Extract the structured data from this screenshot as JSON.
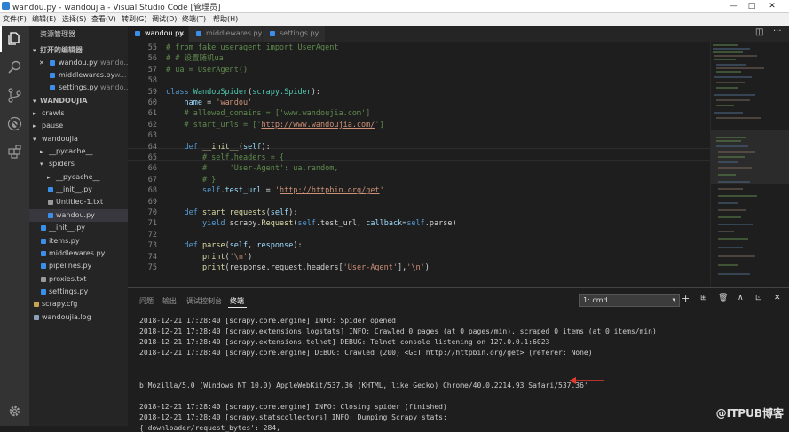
{
  "window": {
    "title": "wandou.py - wandoujia - Visual Studio Code [管理员]",
    "controls": [
      "—",
      "□",
      "✕"
    ]
  },
  "menu": [
    "文件(F)",
    "编辑(E)",
    "选择(S)",
    "查看(V)",
    "转到(G)",
    "调试(D)",
    "终端(T)",
    "帮助(H)"
  ],
  "activity_bar": [
    "explorer-icon",
    "search-icon",
    "source-control-icon",
    "debug-icon",
    "extensions-icon",
    "gear-icon"
  ],
  "sidebar": {
    "title": "资源管理器",
    "open_editors_label": "打开的编辑器",
    "open_editors": [
      {
        "name": "wandou.py",
        "dir": "wando..."
      },
      {
        "name": "middlewares.py",
        "dir": "w..."
      },
      {
        "name": "settings.py",
        "dir": "wando..."
      }
    ],
    "project_label": "WANDOUJIA",
    "tree": [
      {
        "label": "crawls",
        "type": "folder",
        "indent": 1
      },
      {
        "label": "pause",
        "type": "folder",
        "indent": 1
      },
      {
        "label": "wandoujia",
        "type": "folder-open",
        "indent": 1
      },
      {
        "label": "__pycache__",
        "type": "folder",
        "indent": 2
      },
      {
        "label": "spiders",
        "type": "folder-open",
        "indent": 2
      },
      {
        "label": "__pycache__",
        "type": "folder",
        "indent": 3
      },
      {
        "label": "__init__.py",
        "type": "py",
        "indent": 3
      },
      {
        "label": "Untitled-1.txt",
        "type": "txt",
        "indent": 3
      },
      {
        "label": "wandou.py",
        "type": "py",
        "indent": 3,
        "selected": true
      },
      {
        "label": "__init__.py",
        "type": "py",
        "indent": 2
      },
      {
        "label": "items.py",
        "type": "py",
        "indent": 2
      },
      {
        "label": "middlewares.py",
        "type": "py",
        "indent": 2
      },
      {
        "label": "pipelines.py",
        "type": "py",
        "indent": 2
      },
      {
        "label": "proxies.txt",
        "type": "txt",
        "indent": 2
      },
      {
        "label": "settings.py",
        "type": "py",
        "indent": 2
      },
      {
        "label": "scrapy.cfg",
        "type": "cfg",
        "indent": 1
      },
      {
        "label": "wandoujia.log",
        "type": "log",
        "indent": 1
      }
    ]
  },
  "tabs": [
    {
      "label": "wandou.py",
      "active": true
    },
    {
      "label": "middlewares.py",
      "active": false
    },
    {
      "label": "settings.py",
      "active": false
    }
  ],
  "code": [
    {
      "n": "55",
      "segs": [
        [
          "c",
          "# from fake_useragent import UserAgent"
        ]
      ]
    },
    {
      "n": "56",
      "segs": [
        [
          "c",
          "# # 设置随机ua"
        ]
      ]
    },
    {
      "n": "57",
      "segs": [
        [
          "c",
          "# ua = UserAgent()"
        ]
      ]
    },
    {
      "n": "58",
      "segs": []
    },
    {
      "n": "59",
      "segs": [
        [
          "k",
          "class "
        ],
        [
          "t",
          "WandouSpider"
        ],
        [
          "w",
          "("
        ],
        [
          "t",
          "scrapy.Spider"
        ],
        [
          "w",
          "):"
        ]
      ]
    },
    {
      "n": "60",
      "segs": [
        [
          "w",
          "    "
        ],
        [
          "p",
          "name"
        ],
        [
          "w",
          " = "
        ],
        [
          "s",
          "'wandou'"
        ]
      ]
    },
    {
      "n": "61",
      "segs": [
        [
          "c",
          "    # allowed_domains = ['www.wandoujia.com']"
        ]
      ]
    },
    {
      "n": "62",
      "segs": [
        [
          "c",
          "    # start_urls = ['"
        ],
        [
          "u",
          "http://www.wandoujia.com/"
        ],
        [
          "c",
          "']"
        ]
      ]
    },
    {
      "n": "63",
      "segs": []
    },
    {
      "n": "64",
      "segs": [
        [
          "w",
          "    "
        ],
        [
          "k",
          "def "
        ],
        [
          "f",
          "__init__"
        ],
        [
          "w",
          "("
        ],
        [
          "p",
          "self"
        ],
        [
          "w",
          "):"
        ]
      ]
    },
    {
      "n": "65",
      "segs": [
        [
          "c",
          "        # self.headers = {"
        ]
      ]
    },
    {
      "n": "66",
      "segs": [
        [
          "c",
          "        #     'User-Agent': ua.random,"
        ]
      ]
    },
    {
      "n": "67",
      "segs": [
        [
          "c",
          "        # }"
        ]
      ]
    },
    {
      "n": "68",
      "segs": [
        [
          "w",
          "        "
        ],
        [
          "k",
          "self"
        ],
        [
          "w",
          "."
        ],
        [
          "p",
          "test_url"
        ],
        [
          "w",
          " = "
        ],
        [
          "s",
          "'"
        ],
        [
          "u",
          "http://httpbin.org/get"
        ],
        [
          "s",
          "'"
        ]
      ]
    },
    {
      "n": "69",
      "segs": []
    },
    {
      "n": "70",
      "segs": [
        [
          "w",
          "    "
        ],
        [
          "k",
          "def "
        ],
        [
          "f",
          "start_requests"
        ],
        [
          "w",
          "("
        ],
        [
          "p",
          "self"
        ],
        [
          "w",
          "):"
        ]
      ]
    },
    {
      "n": "71",
      "segs": [
        [
          "w",
          "        "
        ],
        [
          "k",
          "yield "
        ],
        [
          "w",
          "scrapy."
        ],
        [
          "f",
          "Request"
        ],
        [
          "w",
          "("
        ],
        [
          "k",
          "self"
        ],
        [
          "w",
          ".test_url, "
        ],
        [
          "p",
          "callback"
        ],
        [
          "w",
          "="
        ],
        [
          "k",
          "self"
        ],
        [
          "w",
          ".parse)"
        ]
      ]
    },
    {
      "n": "72",
      "segs": []
    },
    {
      "n": "73",
      "segs": [
        [
          "w",
          "    "
        ],
        [
          "k",
          "def "
        ],
        [
          "f",
          "parse"
        ],
        [
          "w",
          "("
        ],
        [
          "p",
          "self"
        ],
        [
          "w",
          ", "
        ],
        [
          "p",
          "response"
        ],
        [
          "w",
          "):"
        ]
      ]
    },
    {
      "n": "74",
      "segs": [
        [
          "w",
          "        "
        ],
        [
          "f",
          "print"
        ],
        [
          "w",
          "("
        ],
        [
          "s",
          "'\\n'"
        ],
        [
          "w",
          ")"
        ]
      ]
    },
    {
      "n": "75",
      "segs": [
        [
          "w",
          "        "
        ],
        [
          "f",
          "print"
        ],
        [
          "w",
          "(response.request.headers["
        ],
        [
          "s",
          "'User-Agent'"
        ],
        [
          "w",
          "],"
        ],
        [
          "s",
          "'\\n'"
        ],
        [
          "w",
          ")"
        ]
      ]
    }
  ],
  "panel": {
    "tabs": [
      "问题",
      "输出",
      "调试控制台",
      "终端"
    ],
    "active_tab": "终端",
    "terminal_select": "1: cmd",
    "buttons": [
      "+",
      "⊞",
      "🗑",
      "∧",
      "⊡",
      "✕"
    ],
    "lines": [
      "2018-12-21 17:28:40 [scrapy.core.engine] INFO: Spider opened",
      "2018-12-21 17:28:40 [scrapy.extensions.logstats] INFO: Crawled 0 pages (at 0 pages/min), scraped 0 items (at 0 items/min)",
      "2018-12-21 17:28:40 [scrapy.extensions.telnet] DEBUG: Telnet console listening on 127.0.0.1:6023",
      "2018-12-21 17:28:40 [scrapy.core.engine] DEBUG: Crawled (200) <GET http://httpbin.org/get> (referer: None)",
      "",
      "",
      "b'Mozilla/5.0 (Windows NT 10.0) AppleWebKit/537.36 (KHTML, like Gecko) Chrome/40.0.2214.93 Safari/537.36'",
      "",
      "2018-12-21 17:28:40 [scrapy.core.engine] INFO: Closing spider (finished)",
      "2018-12-21 17:28:40 [scrapy.statscollectors] INFO: Dumping Scrapy stats:",
      "{'downloader/request_bytes': 284,"
    ]
  },
  "watermark": "@ITPUB博客",
  "colors": {
    "accent": "#007acc",
    "arrow": "#e03c31",
    "python_icon": "#3b8eea"
  }
}
